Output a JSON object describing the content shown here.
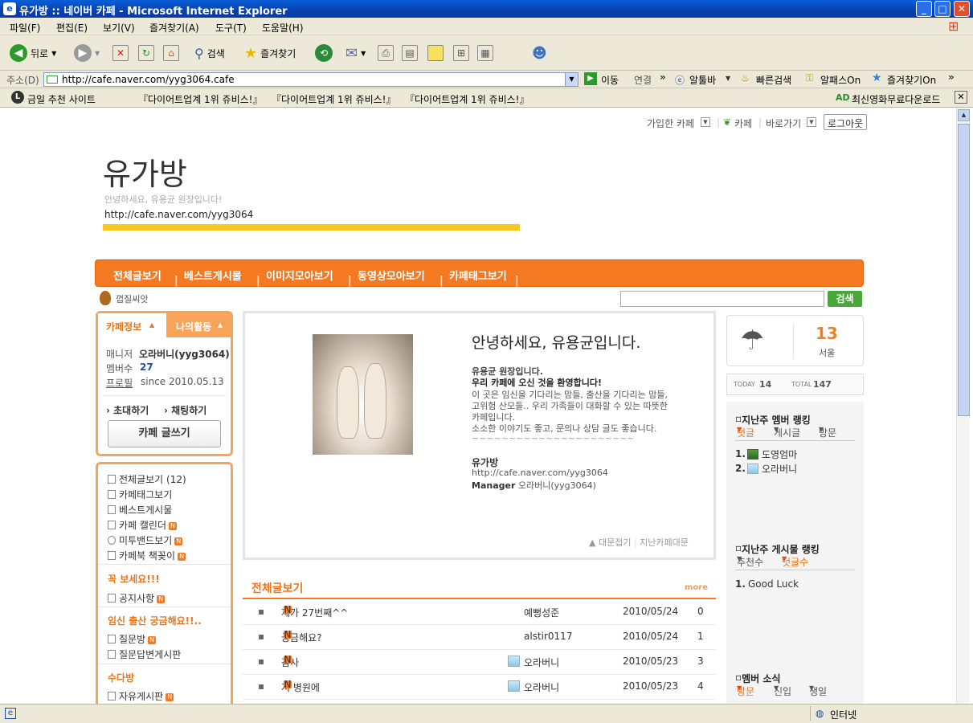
{
  "window": {
    "title": "유가방 :: 네이버 카페 - Microsoft Internet Explorer"
  },
  "menu": [
    "파일(F)",
    "편집(E)",
    "보기(V)",
    "즐겨찾기(A)",
    "도구(T)",
    "도움말(H)"
  ],
  "toolbar": {
    "back": "뒤로",
    "search": "검색",
    "favorites": "즐겨찾기"
  },
  "address": {
    "label": "주소(D)",
    "url": "http://cafe.naver.com/yyg3064.cafe",
    "go": "이동",
    "links": "연결",
    "alttoolbar": "알툴바",
    "quick_search": "빠른검색",
    "alpass": "알패스On",
    "fav_on": "즐겨찾기On"
  },
  "linksbar": {
    "recommend": "금일 추천 사이트",
    "ad1": "『다이어트업계 1위 쥬비스!』",
    "ad2": "『다이어트업계 1위 쥬비스!』",
    "ad3": "『다이어트업계 1위 쥬비스!』",
    "ad_right_tag": "AD",
    "ad_right": "최신영화무료다운로드"
  },
  "topnav": {
    "joined_cafe": "가입한 카페",
    "cafe": "카페",
    "shortcut": "바로가기",
    "logout": "로그아웃"
  },
  "cafe": {
    "name": "유가방",
    "greeting": "안녕하세요, 유용균 원장입니다!",
    "url": "http://cafe.naver.com/yyg3064"
  },
  "nav": [
    "전체글보기",
    "베스트게시물",
    "이미지모아보기",
    "동영상모아보기",
    "카페태그보기"
  ],
  "acorn_label": "껍질씨앗",
  "search_button": "검색",
  "cafeinfo": {
    "tab_info": "카페정보",
    "tab_activity": "나의활동",
    "manager_label": "매니저",
    "manager": "오라버니(yyg3064)",
    "members_label": "멤버수",
    "members": "27",
    "profile_label": "프로필",
    "since": "since 2010.05.13",
    "invite": "초대하기",
    "chat": "채팅하기",
    "write": "카페 글쓰기"
  },
  "menu_links": [
    "전체글보기 (12)",
    "카페태그보기",
    "베스트게시물",
    "카페 캘린더",
    "미투밴드보기",
    "카페북 책꽂이"
  ],
  "sections": [
    {
      "title": "꼭 보세요!!!",
      "items": [
        "공지사항"
      ]
    },
    {
      "title": "임신 출산 궁금해요!!..",
      "items": [
        "질문방",
        "질문답변게시판"
      ]
    },
    {
      "title": "수다방",
      "items": [
        "자유게시판"
      ]
    }
  ],
  "intro": {
    "heading": "안녕하세요, 유용균입니다.",
    "lines": [
      "유용균 원장입니다.",
      "우리 카페에 오신 것을 환영합니다!",
      "이 곳은 임신을 기다리는 맘들, 출산을 기다리는 맘들,",
      "고위험 산모들.. 우리 가족들이 대화할 수 있는 따뜻한",
      "카페입니다.",
      "소소한 이야기도 좋고, 문의나 상담 글도 좋습니다.",
      "~~~~~~~~~~~~~~~~~~~~~~"
    ],
    "cafe_name": "유가방",
    "cafe_url": "http://cafe.naver.com/yyg3064",
    "manager_label": "Manager",
    "manager": "오라버니(yyg3064)",
    "collapse": "대문접기",
    "past": "지난카페대문"
  },
  "weather": {
    "temp": "13",
    "city": "서울"
  },
  "visits": {
    "today_label": "TODAY",
    "today": "14",
    "total_label": "TOTAL",
    "total": "147"
  },
  "board": {
    "title": "전체글보기",
    "more": "more",
    "rows": [
      {
        "title": "제가 27번째^^",
        "author": "예뻥성준",
        "date": "2010/05/24",
        "count": "0"
      },
      {
        "title": "궁금해요?",
        "author": "alstir0117",
        "date": "2010/05/24",
        "count": "1"
      },
      {
        "title": "감사",
        "author": "오라버니",
        "date": "2010/05/23",
        "count": "3"
      },
      {
        "title": "저 병원에",
        "author": "오라버니",
        "date": "2010/05/23",
        "count": "4"
      }
    ]
  },
  "member_rank": {
    "title": "지난주 멤버 랭킹",
    "tabs": [
      "덧글",
      "게시글",
      "방문"
    ],
    "items": [
      "도영엄마",
      "오라버니"
    ]
  },
  "post_rank": {
    "title": "지난주 게시물 랭킹",
    "tabs": [
      "추천수",
      "덧글수"
    ],
    "items": [
      "Good Luck"
    ]
  },
  "member_news": {
    "title": "멤버 소식",
    "tabs": [
      "방문",
      "신입",
      "생일"
    ]
  },
  "status": {
    "zone": "인터넷"
  }
}
